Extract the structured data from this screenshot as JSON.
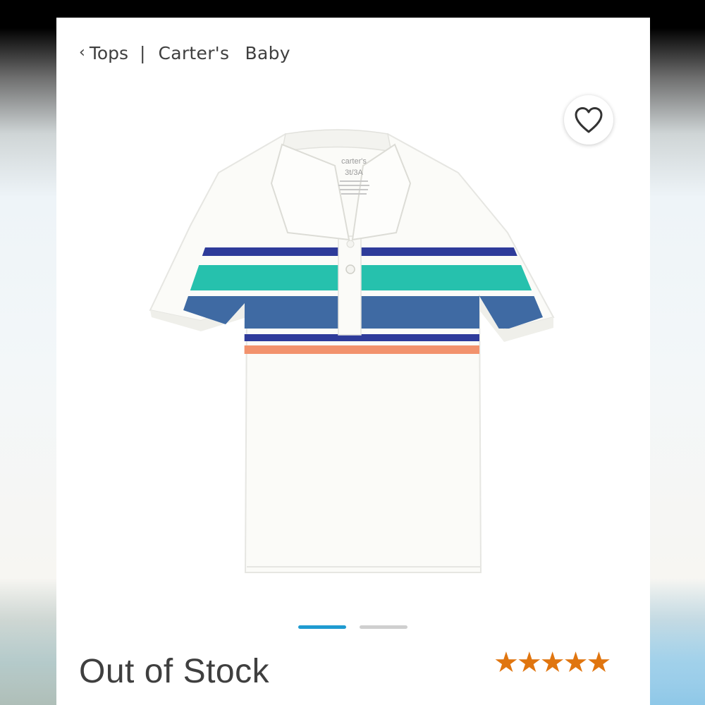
{
  "breadcrumb": {
    "back_label": "Tops",
    "separator": "|",
    "brand_words": [
      "Carter's",
      "Baby"
    ]
  },
  "favorite": {
    "icon": "heart-outline-icon"
  },
  "product": {
    "image_desc_icon": "striped-polo-shirt",
    "shirt_tag_brand": "carter's",
    "shirt_tag_size": "3t/3A",
    "stripe_colors": [
      "#2e3b9a",
      "#26c1ad",
      "#3f6aa3",
      "#2e3b9a",
      "#f2926d"
    ]
  },
  "carousel": {
    "total": 2,
    "active_index": 0,
    "active_color": "#1f9bd1",
    "inactive_color": "#cfcfcf"
  },
  "status": {
    "stock": "Out of Stock"
  },
  "rating": {
    "stars": 5,
    "max": 5,
    "color": "#e0750f"
  }
}
